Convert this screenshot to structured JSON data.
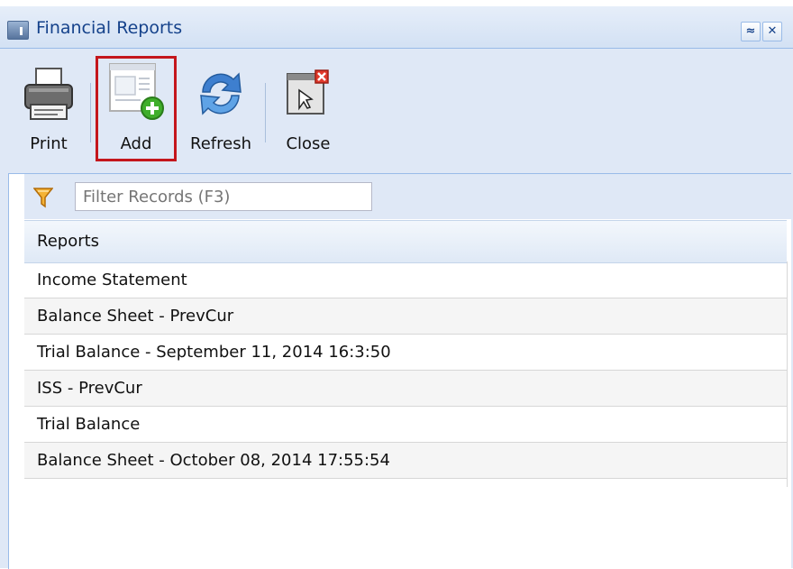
{
  "window": {
    "title": "Financial Reports",
    "title_icon": "report-window-icon",
    "controls": [
      {
        "name": "collapse-icon",
        "glyph": "≈"
      },
      {
        "name": "close-icon",
        "glyph": "✕"
      }
    ]
  },
  "toolbar": {
    "print_label": "Print",
    "add_label": "Add",
    "refresh_label": "Refresh",
    "close_label": "Close",
    "highlighted_button": "Add",
    "highlight_color": "#c4161c"
  },
  "filter": {
    "placeholder": "Filter Records (F3)",
    "icon": "funnel-icon"
  },
  "grid": {
    "column_header": "Reports",
    "rows": [
      "Income Statement",
      "Balance Sheet - PrevCur",
      "Trial Balance - September 11, 2014 16:3:50",
      "ISS - PrevCur",
      "Trial Balance",
      "Balance Sheet - October 08, 2014 17:55:54"
    ]
  },
  "colors": {
    "panel_bg": "#dfe8f6",
    "title_text": "#15428b",
    "border": "#99bbe8"
  }
}
